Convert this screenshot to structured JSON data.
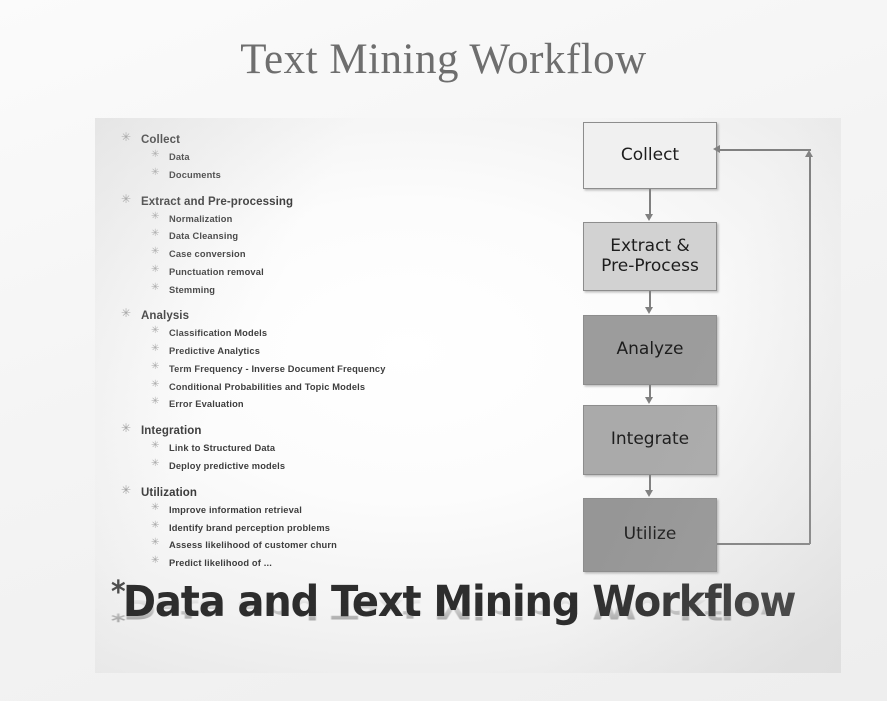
{
  "slide": {
    "title": "Text Mining Workflow"
  },
  "panel": {
    "caption": "Data and Text Mining Workflow",
    "caption_bullet": "*",
    "outline": {
      "bullet_glyph": "✳",
      "groups": [
        {
          "label": "Collect",
          "items": [
            "Data",
            "Documents"
          ]
        },
        {
          "label": "Extract and Pre-processing",
          "items": [
            "Normalization",
            "Data Cleansing",
            "Case conversion",
            "Punctuation removal",
            "Stemming"
          ]
        },
        {
          "label": "Analysis",
          "items": [
            "Classification Models",
            "Predictive Analytics",
            "Term Frequency - Inverse Document Frequency",
            "Conditional Probabilities and Topic Models",
            "Error Evaluation"
          ]
        },
        {
          "label": "Integration",
          "items": [
            "Link to Structured Data",
            "Deploy predictive models"
          ]
        },
        {
          "label": "Utilization",
          "items": [
            "Improve information retrieval",
            "Identify brand perception problems",
            "Assess likelihood of customer churn",
            "Predict likelihood of ..."
          ]
        }
      ]
    },
    "flowchart": {
      "nodes": [
        {
          "id": "collect",
          "label": "Collect",
          "fill": "#f0f0f0"
        },
        {
          "id": "extract",
          "label": "Extract &\nPre-Process",
          "line1": "Extract &",
          "line2": "Pre-Process",
          "fill": "#d2d2d2"
        },
        {
          "id": "analyze",
          "label": "Analyze",
          "fill": "#9c9c9c"
        },
        {
          "id": "integrate",
          "label": "Integrate",
          "fill": "#aaaaaa"
        },
        {
          "id": "utilize",
          "label": "Utilize",
          "fill": "#969696"
        }
      ],
      "edges": [
        {
          "from": "collect",
          "to": "extract",
          "kind": "down"
        },
        {
          "from": "extract",
          "to": "analyze",
          "kind": "down"
        },
        {
          "from": "analyze",
          "to": "integrate",
          "kind": "down"
        },
        {
          "from": "integrate",
          "to": "utilize",
          "kind": "down"
        },
        {
          "from": "utilize",
          "to": "collect",
          "kind": "feedback"
        }
      ],
      "line_color": "#808080"
    }
  }
}
